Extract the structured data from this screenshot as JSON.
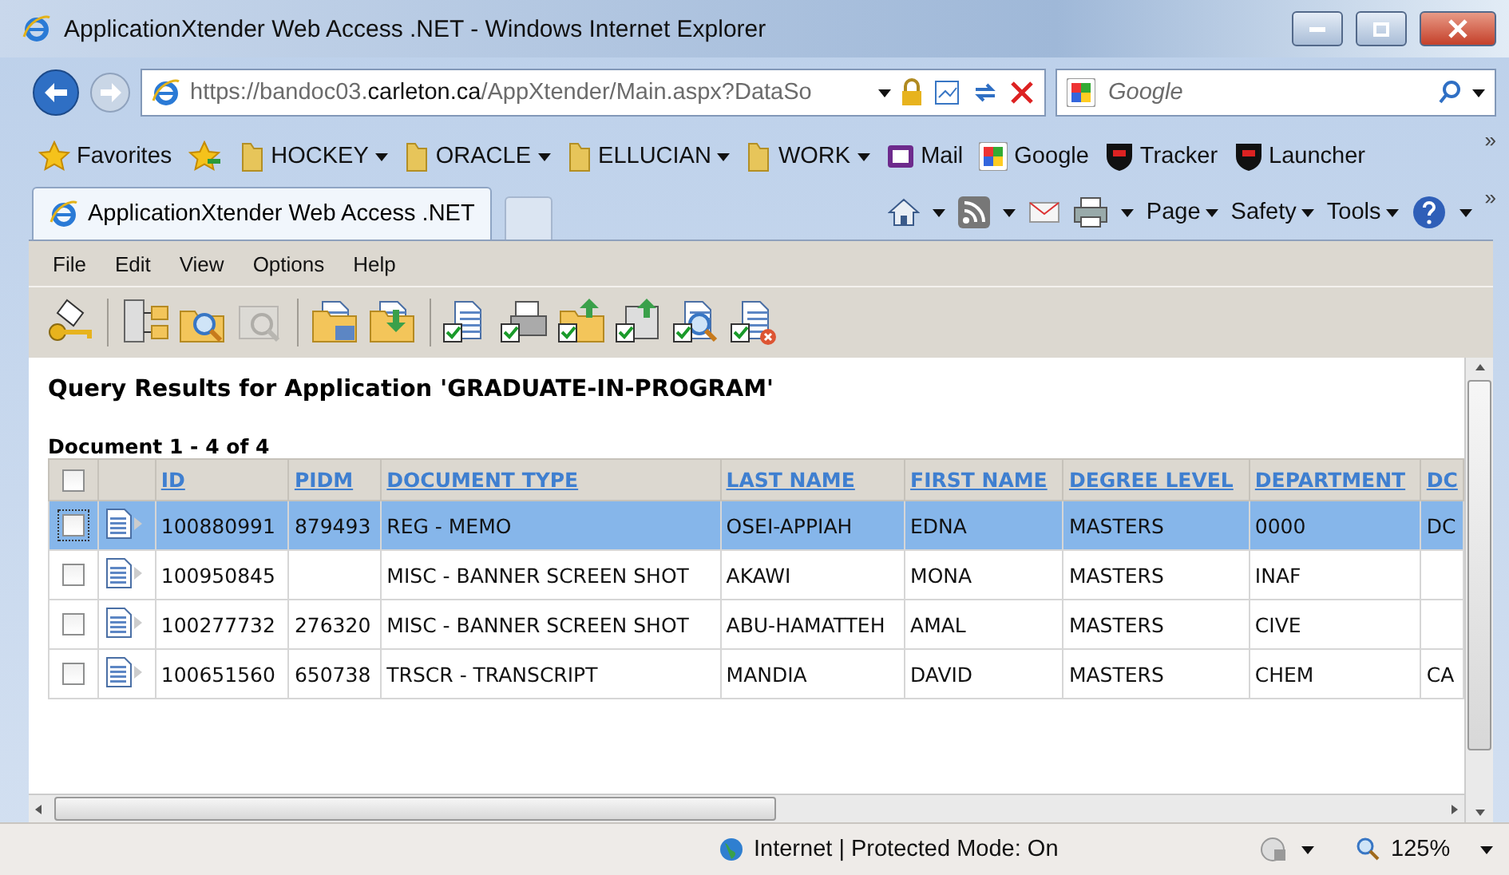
{
  "window": {
    "title": "ApplicationXtender Web Access .NET - Windows Internet Explorer"
  },
  "address_bar": {
    "url_prefix": "https://bandoc03.",
    "url_domain": "carleton.ca",
    "url_rest": "/AppXtender/Main.aspx?DataSo",
    "search_placeholder": "Google"
  },
  "favorites_bar": {
    "label": "Favorites",
    "items": [
      {
        "kind": "folder",
        "label": "HOCKEY"
      },
      {
        "kind": "folder",
        "label": "ORACLE"
      },
      {
        "kind": "folder",
        "label": "ELLUCIAN"
      },
      {
        "kind": "folder",
        "label": "WORK"
      },
      {
        "kind": "mail",
        "label": "Mail"
      },
      {
        "kind": "google",
        "label": "Google"
      },
      {
        "kind": "shield",
        "label": "Tracker"
      },
      {
        "kind": "shield",
        "label": "Launcher"
      }
    ],
    "more": "»"
  },
  "tabs": [
    {
      "label": "ApplicationXtender Web Access .NET",
      "selected": true
    }
  ],
  "command_bar": {
    "menus": [
      "Page",
      "Safety",
      "Tools"
    ],
    "more": "»"
  },
  "menu": [
    "File",
    "Edit",
    "View",
    "Options",
    "Help"
  ],
  "toolbar": [
    {
      "kind": "key",
      "disabled": false
    },
    {
      "kind": "sep"
    },
    {
      "kind": "tree",
      "disabled": false
    },
    {
      "kind": "folder-search",
      "disabled": false
    },
    {
      "kind": "search",
      "disabled": true
    },
    {
      "kind": "sep"
    },
    {
      "kind": "folder-table",
      "disabled": false
    },
    {
      "kind": "folder-down",
      "disabled": false
    },
    {
      "kind": "sep"
    },
    {
      "kind": "doc-check",
      "disabled": false
    },
    {
      "kind": "printer-check",
      "disabled": false
    },
    {
      "kind": "folder-up-check",
      "disabled": false
    },
    {
      "kind": "doc-up-check",
      "disabled": false
    },
    {
      "kind": "doc-search-check",
      "disabled": false
    },
    {
      "kind": "doc-delete-check",
      "disabled": false
    }
  ],
  "query": {
    "title": "Query Results for Application 'GRADUATE-IN-PROGRAM'",
    "count": "Document 1 - 4 of 4"
  },
  "table": {
    "header_checked": false,
    "columns": [
      "ID",
      "PIDM",
      "DOCUMENT TYPE",
      "LAST NAME",
      "FIRST NAME",
      "DEGREE LEVEL",
      "DEPARTMENT",
      "DC"
    ],
    "rows": [
      {
        "selected": true,
        "checked": false,
        "cells": [
          "100880991",
          "879493",
          "REG - MEMO",
          "OSEI-APPIAH",
          "EDNA",
          "MASTERS",
          "0000",
          "DC"
        ]
      },
      {
        "selected": false,
        "checked": false,
        "cells": [
          "100950845",
          "",
          "MISC - BANNER SCREEN SHOT",
          "AKAWI",
          "MONA",
          "MASTERS",
          "INAF",
          ""
        ]
      },
      {
        "selected": false,
        "checked": false,
        "cells": [
          "100277732",
          "276320",
          "MISC - BANNER SCREEN SHOT",
          "ABU-HAMATTEH",
          "AMAL",
          "MASTERS",
          "CIVE",
          ""
        ]
      },
      {
        "selected": false,
        "checked": false,
        "cells": [
          "100651560",
          "650738",
          "TRSCR - TRANSCRIPT",
          "MANDIA",
          "DAVID",
          "MASTERS",
          "CHEM",
          "CA"
        ]
      }
    ]
  },
  "status_bar": {
    "zone": "Internet | Protected Mode: On",
    "zoom": "125%"
  }
}
